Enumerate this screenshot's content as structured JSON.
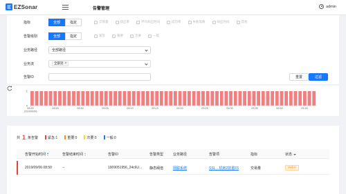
{
  "header": {
    "logo": "EZSonar",
    "title": "告警管理",
    "user": "admin"
  },
  "filters": {
    "metric": {
      "label": "指标",
      "buttons": [
        "全部",
        "指定"
      ],
      "options": [
        "交易量",
        "响应率",
        "平均响应时间",
        "成功率",
        "失败笔数",
        "响应时间",
        "其他"
      ]
    },
    "level": {
      "label": "告警级别",
      "buttons": [
        "全部",
        "指定"
      ],
      "options": [
        "紧急",
        "重要",
        "次要",
        "一般"
      ]
    },
    "path": {
      "label": "业务路径",
      "value": "全部路径"
    },
    "flow": {
      "label": "业务流",
      "tag": "全部流",
      "tag_close": "×"
    },
    "alarm_id": {
      "label": "告警ID",
      "value": ""
    },
    "reset_label": "重置",
    "filter_label": "过滤"
  },
  "colors": {
    "accent": "#1677ff",
    "alarm_bar": "#f08080",
    "critical": "#e8413c",
    "important": "#fa8c16",
    "minor": "#fadb14",
    "general": "#1677ff"
  },
  "chart_data": {
    "type": "bar",
    "title": "",
    "xlabel": "",
    "ylabel": "",
    "ylim": [
      0,
      1
    ],
    "yticks": [
      "1",
      "0"
    ],
    "x_labels": [
      "08:50\n2019/09/06",
      "08:55",
      "08:50",
      "09:05",
      "09:10",
      "09:15",
      "09:20",
      "09:25",
      "09:30",
      "09:35",
      "09:40",
      "09:45"
    ],
    "series": [
      {
        "values": [
          1,
          1,
          1,
          1,
          1,
          1,
          1,
          1,
          1,
          1,
          1,
          1,
          1,
          1,
          1,
          1,
          1,
          1,
          1,
          1,
          1,
          1,
          1,
          1,
          1,
          1,
          1,
          1,
          1,
          1,
          1,
          1,
          1,
          1,
          1,
          1,
          1,
          1,
          1,
          1,
          1,
          1,
          1,
          1,
          1,
          1,
          1,
          1,
          1,
          1,
          1,
          1,
          1,
          1,
          1,
          1,
          1,
          1,
          1,
          1,
          1,
          1
        ]
      }
    ],
    "grid": false,
    "legend": "none"
  },
  "summary": {
    "prefix": "共",
    "total": "1",
    "suffix": "条告警",
    "levels": [
      {
        "label": "紧急:1",
        "color": "#e8413c"
      },
      {
        "label": "重要:0",
        "color": "#fa8c16"
      },
      {
        "label": "次要:0",
        "color": "#fadb14"
      },
      {
        "label": "一般:0",
        "color": "#1677ff"
      }
    ]
  },
  "table": {
    "headers": [
      "告警开始时间",
      "告警结束时间",
      "告警ID",
      "告警类型",
      "业务路径",
      "告警项",
      "指标",
      "状态"
    ],
    "rows": [
      [
        "2019/09/06 08:50",
        "--",
        "1909051956_24c6U...",
        "静态阈值",
        "网联系统",
        "SSL→机房2前置F5",
        "交易量",
        "持续中"
      ]
    ]
  }
}
